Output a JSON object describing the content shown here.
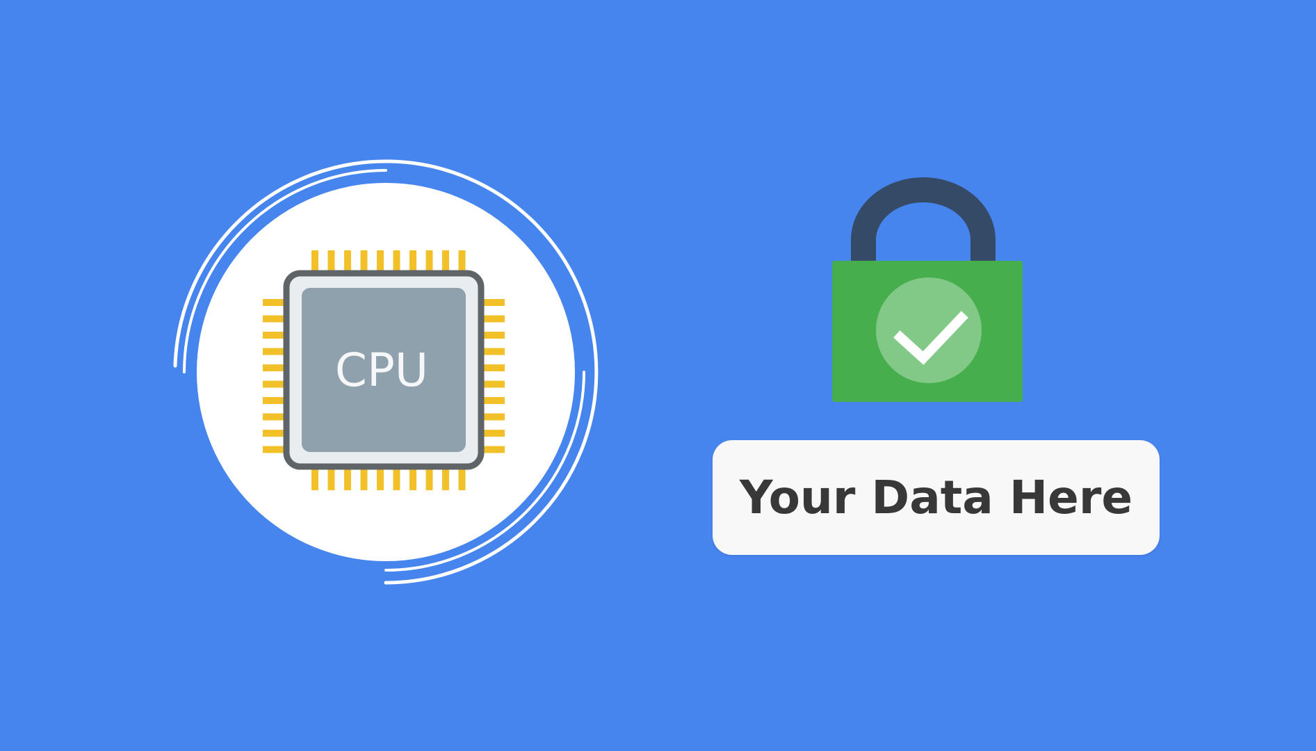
{
  "colors": {
    "background": "#4785ee",
    "circle": "#ffffff",
    "ring": "#ffffff",
    "chip_frame": "#5e6467",
    "chip_inner": "#e9edef",
    "chip_core": "#8fa1ac",
    "pins": "#f2c12a",
    "lock_shackle": "#344a67",
    "lock_body": "#47ae4d",
    "check_circle": "#82c887",
    "check_mark": "#ffffff",
    "label_box": "#f8f8f8",
    "label_text": "#383838"
  },
  "icons": {
    "chip": "cpu-chip-icon",
    "lock": "padlock-icon",
    "check": "checkmark-icon"
  },
  "cpu": {
    "label": "CPU"
  },
  "data_box": {
    "label": "Your Data Here"
  }
}
